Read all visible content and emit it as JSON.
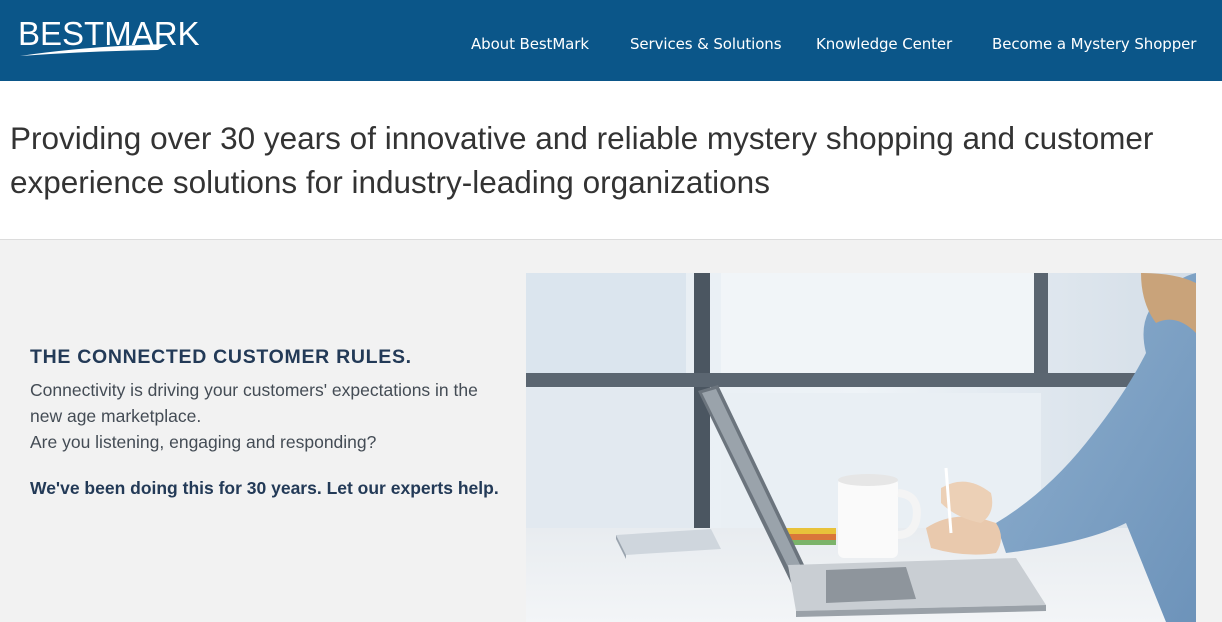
{
  "brand": {
    "logo_text": "BESTMARK"
  },
  "nav": {
    "items": [
      {
        "label": "About BestMark"
      },
      {
        "label": "Services & Solutions"
      },
      {
        "label": "Knowledge Center"
      },
      {
        "label": "Become a Mystery Shopper"
      }
    ]
  },
  "hero": {
    "headline": "Providing over 30 years of innovative and reliable mystery shopping and customer experience solutions for industry-leading organizations"
  },
  "feature": {
    "heading": "THE CONNECTED CUSTOMER RULES.",
    "body_line1": "Connectivity is driving your customers' expectations in the new age marketplace.",
    "body_line2": "Are you listening, engaging and responding?",
    "emphasis": "We've been doing this for 30 years. Let our experts help."
  },
  "colors": {
    "header": "#0b5689",
    "heading_text": "#233a57",
    "section_bg": "#f2f2f2"
  }
}
